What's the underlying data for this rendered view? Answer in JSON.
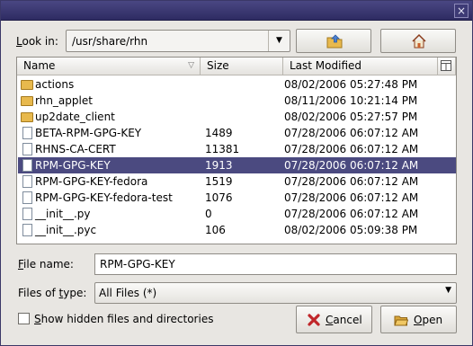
{
  "window": {
    "close_glyph": "×"
  },
  "look_in": {
    "label_prefix": "",
    "label_mnemonic": "L",
    "label_rest": "ook in:",
    "path": "/usr/share/rhn"
  },
  "columns": {
    "name": "Name",
    "size": "Size",
    "modified": "Last Modified"
  },
  "files": [
    {
      "name": "actions",
      "size": "",
      "modified": "08/02/2006 05:27:48 PM",
      "type": "folder"
    },
    {
      "name": "rhn_applet",
      "size": "",
      "modified": "08/11/2006 10:21:14 PM",
      "type": "folder"
    },
    {
      "name": "up2date_client",
      "size": "",
      "modified": "08/02/2006 05:27:57 PM",
      "type": "folder"
    },
    {
      "name": "BETA-RPM-GPG-KEY",
      "size": "1489",
      "modified": "07/28/2006 06:07:12 AM",
      "type": "file"
    },
    {
      "name": "RHNS-CA-CERT",
      "size": "11381",
      "modified": "07/28/2006 06:07:12 AM",
      "type": "file"
    },
    {
      "name": "RPM-GPG-KEY",
      "size": "1913",
      "modified": "07/28/2006 06:07:12 AM",
      "type": "file",
      "selected": true
    },
    {
      "name": "RPM-GPG-KEY-fedora",
      "size": "1519",
      "modified": "07/28/2006 06:07:12 AM",
      "type": "file"
    },
    {
      "name": "RPM-GPG-KEY-fedora-test",
      "size": "1076",
      "modified": "07/28/2006 06:07:12 AM",
      "type": "file"
    },
    {
      "name": "__init__.py",
      "size": "0",
      "modified": "07/28/2006 06:07:12 AM",
      "type": "file"
    },
    {
      "name": "__init__.pyc",
      "size": "106",
      "modified": "08/02/2006 05:09:38 PM",
      "type": "file"
    }
  ],
  "file_name": {
    "label_prefix": "",
    "label_mnemonic": "F",
    "label_rest": "ile name:",
    "value": "RPM-GPG-KEY"
  },
  "files_of_type": {
    "label_prefix": "Files of ",
    "label_mnemonic": "t",
    "label_rest": "ype:",
    "value": "All Files (*)"
  },
  "hidden": {
    "label_prefix": "",
    "label_mnemonic": "S",
    "label_rest": "how hidden files and directories"
  },
  "buttons": {
    "cancel_prefix": "",
    "cancel_mnemonic": "C",
    "cancel_rest": "ancel",
    "open_prefix": "",
    "open_mnemonic": "O",
    "open_rest": "pen"
  },
  "colors": {
    "selection": "#4b4a80",
    "title": "#3b3868"
  }
}
